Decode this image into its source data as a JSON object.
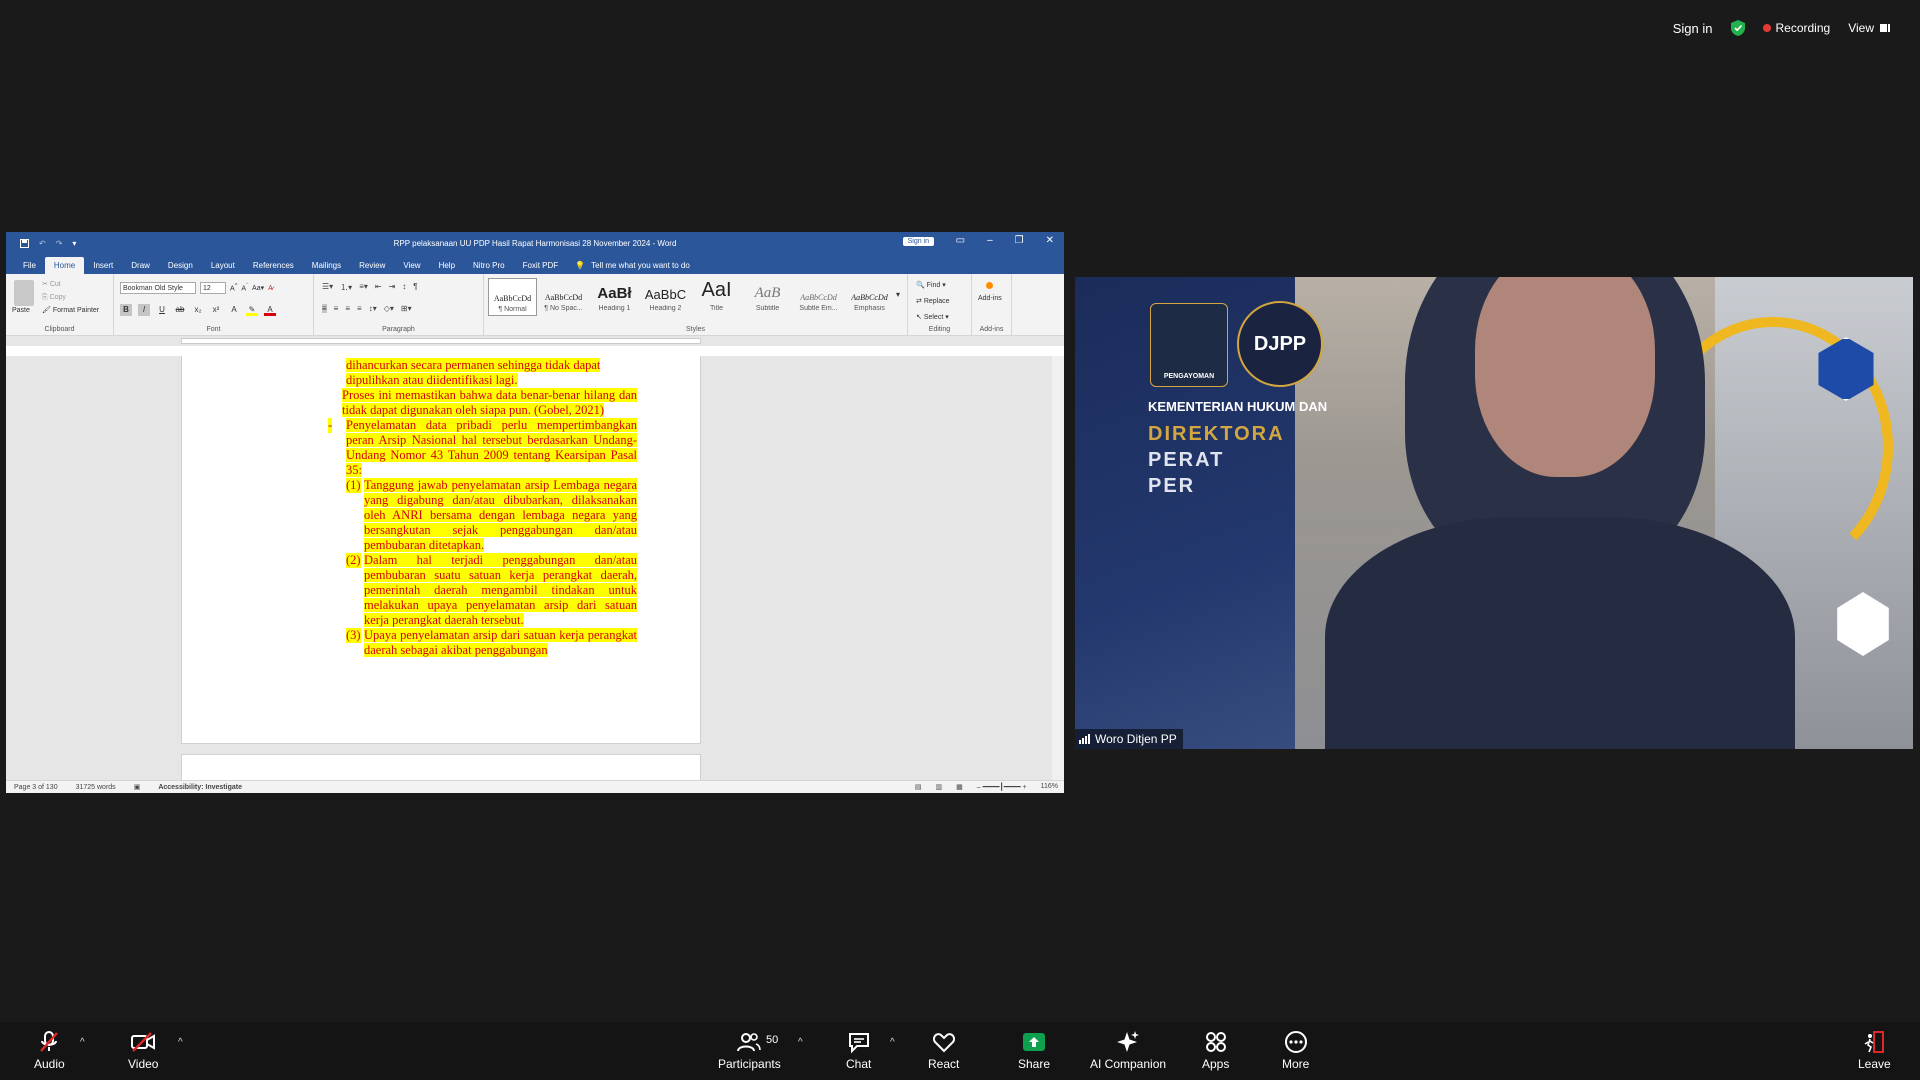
{
  "zoom_top": {
    "sign_in": "Sign in",
    "recording": "Recording",
    "view": "View"
  },
  "word": {
    "title": "RPP pelaksanaan UU PDP Hasil Rapat Harmonisasi 28 November 2024  -  Word",
    "sign_in": "Sign in",
    "tabs": [
      "File",
      "Home",
      "Insert",
      "Draw",
      "Design",
      "Layout",
      "References",
      "Mailings",
      "Review",
      "View",
      "Help",
      "Nitro Pro",
      "Foxit PDF"
    ],
    "tell_me": "Tell me what you want to do",
    "clipboard": {
      "paste": "Paste",
      "cut": "Cut",
      "copy": "Copy",
      "format_painter": "Format Painter",
      "label": "Clipboard"
    },
    "font": {
      "name": "Bookman Old Style",
      "size": "12",
      "label": "Font"
    },
    "paragraph_label": "Paragraph",
    "styles": [
      {
        "sample": "AaBbCcDd",
        "name": "¶ Normal"
      },
      {
        "sample": "AaBbCcDd",
        "name": "¶ No Spac..."
      },
      {
        "sample": "AaBł",
        "name": "Heading 1"
      },
      {
        "sample": "AaBbC",
        "name": "Heading 2"
      },
      {
        "sample": "AaI",
        "name": "Title"
      },
      {
        "sample": "AaB",
        "name": "Subtitle"
      },
      {
        "sample": "AaBbCcDd",
        "name": "Subtle Em..."
      },
      {
        "sample": "AaBbCcDd",
        "name": "Emphasis"
      }
    ],
    "styles_label": "Styles",
    "editing": {
      "find": "Find",
      "replace": "Replace",
      "select": "Select",
      "label": "Editing"
    },
    "addins": {
      "button": "Add-ins",
      "label": "Add-ins"
    },
    "doc": {
      "line1": "dihancurkan secara permanen sehingga tidak dapat",
      "line2": "dipulihkan atau diidentifikasi lagi.",
      "para1": "Proses ini memastikan bahwa data benar-benar hilang dan tidak dapat digunakan oleh siapa pun. (Gobel, 2021)",
      "bullet_mark": "-",
      "bullet": "Penyelamatan data pribadi perlu mempertimbangkan peran Arsip Nasional hal tersebut berdasarkan Undang-Undang Nomor 43 Tahun 2009 tentang Kearsipan Pasal 35:",
      "items": [
        {
          "mark": "(1)",
          "text": "Tanggung jawab penyelamatan arsip Lembaga negara yang digabung dan/atau dibubarkan, dilaksanakan oleh ANRI bersama dengan lembaga negara yang bersangkutan sejak penggabungan dan/atau pembubaran ditetapkan."
        },
        {
          "mark": "(2)",
          "text": "Dalam hal terjadi penggabungan dan/atau pembubaran suatu satuan kerja perangkat daerah, pemerintah daerah mengambil tindakan untuk melakukan upaya penyelamatan arsip dari satuan kerja perangkat daerah tersebut."
        },
        {
          "mark": "(3)",
          "text": "Upaya penyelamatan arsip dari satuan kerja perangkat daerah sebagai akibat penggabungan"
        }
      ]
    },
    "status": {
      "page": "Page 3 of 130",
      "words": "31725 words",
      "accessibility": "Accessibility: Investigate",
      "zoom": "116%"
    }
  },
  "video": {
    "participant_name": "Woro Ditjen PP",
    "background": {
      "logo1_text": "PENGAYOMAN",
      "logo2_text": "DJPP",
      "kementerian": "KEMENTERIAN HUKUM DAN",
      "direktorat": "DIREKTORA",
      "perat": "PERAT",
      "per": "PER"
    }
  },
  "toolbar": {
    "audio": "Audio",
    "video": "Video",
    "participants": "Participants",
    "participants_count": "50",
    "chat": "Chat",
    "react": "React",
    "share": "Share",
    "ai": "AI Companion",
    "apps": "Apps",
    "more": "More",
    "leave": "Leave"
  },
  "colors": {
    "word_blue": "#2b579a",
    "doc_red": "#d7000f",
    "highlight": "#ffff00",
    "share_green": "#0e9f4f",
    "leave_red": "#e02828"
  }
}
